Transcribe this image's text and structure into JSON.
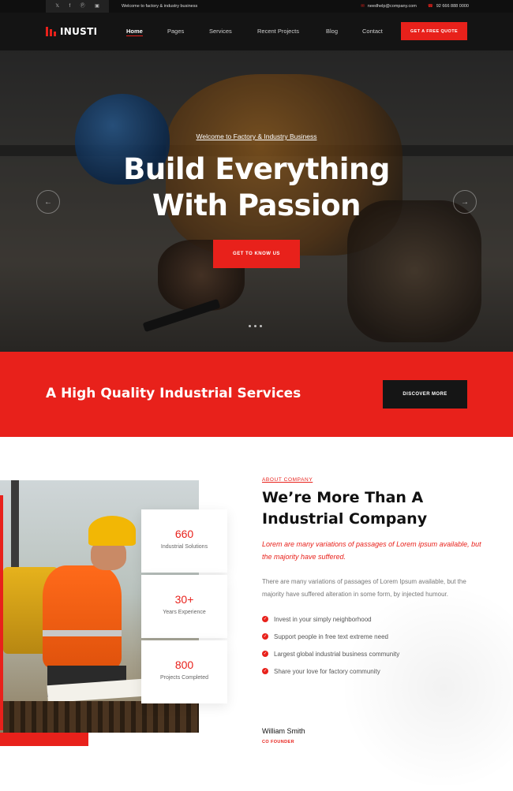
{
  "topbar": {
    "social_icons": [
      "twitter-icon",
      "facebook-icon",
      "pinterest-icon",
      "instagram-icon"
    ],
    "welcome": "Welcome to factory & industry business",
    "email": "needhelp@company.com",
    "phone": "92 666 888 0000"
  },
  "nav": {
    "logo": "INUSTI",
    "items": [
      "Home",
      "Pages",
      "Services",
      "Recent Projects",
      "Blog",
      "Contact"
    ],
    "active": "Home",
    "cta": "GET A FREE QUOTE"
  },
  "hero": {
    "subtitle": "Welcome to Factory & Industry Business",
    "title_line1": "Build Everything",
    "title_line2": "With Passion",
    "button": "GET TO KNOW US",
    "slides": 3
  },
  "band": {
    "title": "A High Quality Industrial Services",
    "button": "DISCOVER MORE"
  },
  "about": {
    "kicker": "ABOUT COMPANY",
    "title_line1": "We’re More Than A",
    "title_line2": "Industrial Company",
    "lead": "Lorem are many variations of passages of Lorem ipsum available, but the majority have suffered.",
    "body": "There are many variations of passages of Lorem Ipsum available, but the majority have suffered alteration in some form, by injected humour.",
    "checklist": [
      "Invest in your simply neighborhood",
      "Support people in free text extreme need",
      "Largest global industrial business community",
      "Share your love for factory community"
    ],
    "signature_name": "William Smith",
    "signature_role": "CO FOUNDER",
    "stats": [
      {
        "value": "660",
        "label": "Industrial Solutions"
      },
      {
        "value": "30+",
        "label": "Years Experience"
      },
      {
        "value": "800",
        "label": "Projects Completed"
      }
    ]
  },
  "colors": {
    "accent": "#e8211b",
    "dark": "#141414"
  }
}
